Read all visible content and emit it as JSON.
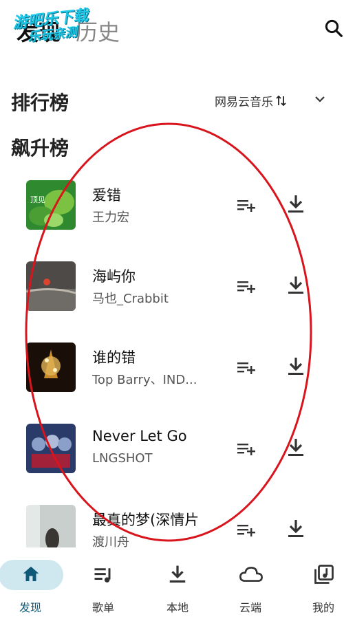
{
  "watermark": {
    "line1": "游吧乐下载",
    "line2": "乐玩亲测"
  },
  "top_tabs": {
    "discover": "发现",
    "history": "历史"
  },
  "section": {
    "title": "排行榜",
    "source": "网易云音乐"
  },
  "list_title": "飙升榜",
  "songs": [
    {
      "name": "爱错",
      "artist": "王力宏",
      "cover_text": "顶见"
    },
    {
      "name": "海屿你",
      "artist": "马也_Crabbit"
    },
    {
      "name": "谁的错",
      "artist": "Top Barry、IND..."
    },
    {
      "name": "Never Let Go",
      "artist": "LNGSHOT"
    },
    {
      "name": "最真的梦(深情片",
      "artist": "渡川舟"
    }
  ],
  "bottom_nav": [
    {
      "label": "发现",
      "icon": "home-icon",
      "active": true
    },
    {
      "label": "歌单",
      "icon": "playlist-icon",
      "active": false
    },
    {
      "label": "本地",
      "icon": "download-icon",
      "active": false
    },
    {
      "label": "云端",
      "icon": "cloud-icon",
      "active": false
    },
    {
      "label": "我的",
      "icon": "library-icon",
      "active": false
    }
  ],
  "colors": {
    "active": "#0f5a78",
    "pill": "#cfe8f0",
    "annotation": "#d8141c"
  }
}
